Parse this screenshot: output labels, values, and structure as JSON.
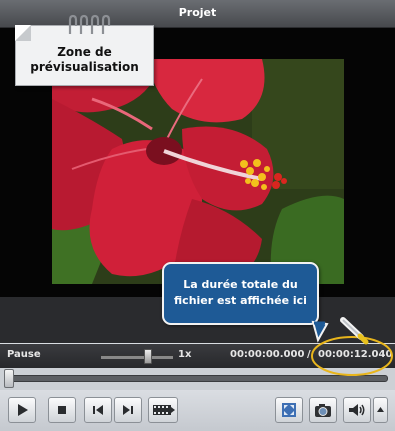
{
  "window": {
    "title": "Projet"
  },
  "callouts": {
    "preview_zone": {
      "line1": "Zone de",
      "line2": "prévisualisation"
    },
    "duration_note": {
      "line1": "La durée totale du",
      "line2": "fichier est affichée ici"
    }
  },
  "player": {
    "state": "Pause",
    "speed": "1x",
    "current_time": "00:00:00.000",
    "separator": "/",
    "total_time": "00:00:12.040",
    "position_fraction": 0.0
  },
  "controls": {
    "play": "play-icon",
    "stop": "stop-icon",
    "previous": "previous-frame-icon",
    "next": "next-frame-icon",
    "filmstrip": "filmstrip-icon",
    "fullscreen": "fullscreen-icon",
    "snapshot": "camera-icon",
    "volume": "speaker-icon",
    "volume_menu": "triangle-up-icon"
  },
  "colors": {
    "callout_blue": "#1e5a96",
    "highlight_ring": "#e8b51c"
  }
}
